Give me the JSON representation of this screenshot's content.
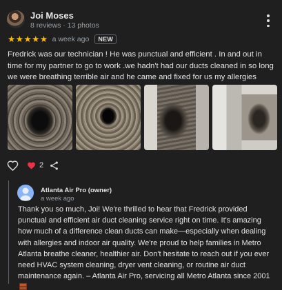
{
  "review": {
    "author_name": "Joi Moses",
    "author_meta": "8 reviews · 13 photos",
    "rating": 5,
    "stars": [
      "★",
      "★",
      "★",
      "★",
      "★"
    ],
    "time_ago": "a week ago",
    "badge": "NEW",
    "text": "Fredrick was our technician ! He was punctual and efficient . In and out in time for my partner to go to work .we hadn't had our ducts cleaned in so long we were breathing terrible air and he came and fixed for us my allergies thank you .",
    "photos": [
      "duct-photo-1",
      "duct-photo-2",
      "duct-photo-3",
      "duct-photo-4"
    ]
  },
  "actions": {
    "like_icon": "thumb-up-outline-icon",
    "reaction_icon": "heart-icon",
    "reaction_count": "2",
    "share_icon": "share-icon"
  },
  "owner_reply": {
    "name": "Atlanta Air Pro (owner)",
    "time_ago": "a week ago",
    "text": "Thank you so much, Joi! We're thrilled to hear that Fredrick provided punctual and efficient air duct cleaning service right on time. It's amazing how much of a difference clean ducts can make—especially when dealing with allergies and indoor air quality. We're proud to help families in Metro Atlanta breathe cleaner, healthier air. Don't hesitate to reach out if you ever need HVAC system cleaning, dryer vent cleaning, or routine air duct maintenance again. – Atlanta Air Pro, servicing all Metro Atlanta since 2001"
  },
  "colors": {
    "background": "#1f1f1f",
    "star": "#fbbc04",
    "heart": "#e8334a",
    "owner_avatar": "#8ab4f8",
    "muted_text": "#9aa0a6"
  }
}
